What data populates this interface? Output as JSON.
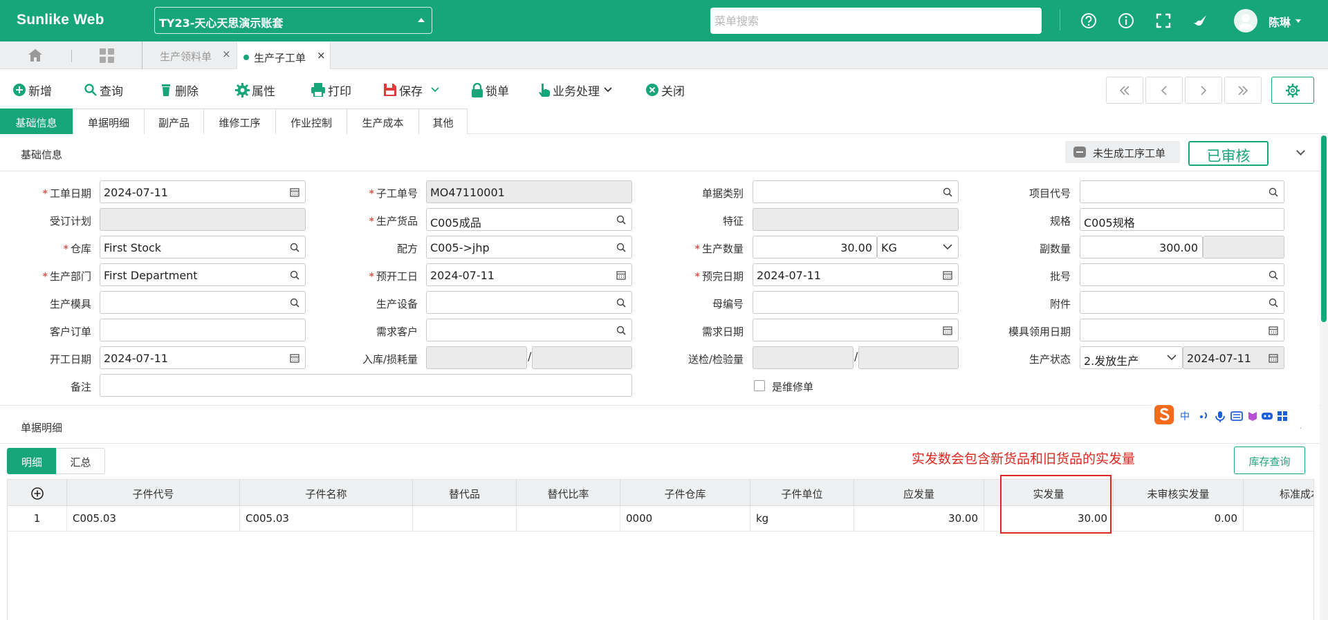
{
  "app": {
    "logo": "Sunlike Web",
    "account": "TY23-天心天思演示账套",
    "search_placeholder": "菜单搜索",
    "user_name": "陈琳",
    "icons": [
      "help-icon",
      "info-icon",
      "fullscreen-icon",
      "theme-icon"
    ]
  },
  "page_tabs": [
    {
      "label": "生产领料单",
      "active": false
    },
    {
      "label": "生产子工单",
      "active": true
    }
  ],
  "toolbar": {
    "new": "新增",
    "query": "查询",
    "delete": "删除",
    "properties": "属性",
    "print": "打印",
    "save": "保存",
    "lock": "锁单",
    "business": "业务处理",
    "close": "关闭"
  },
  "section_tabs": [
    "基础信息",
    "单据明细",
    "副产品",
    "维修工序",
    "作业控制",
    "生产成本",
    "其他"
  ],
  "basic_info": {
    "title": "基础信息",
    "not_generated_label": "未生成工序工单",
    "stamp": "已审核"
  },
  "fields": {
    "work_date": {
      "label": "工单日期",
      "value": "2024-07-11"
    },
    "sub_order_no": {
      "label": "子工单号",
      "value": "MO47110001"
    },
    "doc_category": {
      "label": "单据类别",
      "value": ""
    },
    "project_code": {
      "label": "项目代号",
      "value": ""
    },
    "order_plan": {
      "label": "受订计划",
      "value": ""
    },
    "product": {
      "label": "生产货品",
      "value": "C005成品"
    },
    "feature": {
      "label": "特征",
      "value": ""
    },
    "spec": {
      "label": "规格",
      "value": "C005规格"
    },
    "warehouse": {
      "label": "仓库",
      "value": "First Stock"
    },
    "formula": {
      "label": "配方",
      "value": "C005->jhp"
    },
    "prod_qty": {
      "label": "生产数量",
      "value": "30.00",
      "unit": "KG"
    },
    "sub_qty": {
      "label": "副数量",
      "value": "300.00"
    },
    "department": {
      "label": "生产部门",
      "value": "First Department"
    },
    "plan_start": {
      "label": "预开工日",
      "value": "2024-07-11"
    },
    "plan_finish": {
      "label": "预完日期",
      "value": "2024-07-11"
    },
    "batch_no": {
      "label": "批号",
      "value": ""
    },
    "mold": {
      "label": "生产模具",
      "value": ""
    },
    "equipment": {
      "label": "生产设备",
      "value": ""
    },
    "parent_no": {
      "label": "母编号",
      "value": ""
    },
    "attachment": {
      "label": "附件",
      "value": ""
    },
    "customer_order": {
      "label": "客户订单",
      "value": ""
    },
    "demand_customer": {
      "label": "需求客户",
      "value": ""
    },
    "demand_date": {
      "label": "需求日期",
      "value": ""
    },
    "mold_use_date": {
      "label": "模具领用日期",
      "value": ""
    },
    "start_date": {
      "label": "开工日期",
      "value": "2024-07-11"
    },
    "in_loss": {
      "label": "入库/损耗量",
      "value": ""
    },
    "inspect": {
      "label": "送检/检验量",
      "value": ""
    },
    "status": {
      "label": "生产状态",
      "value": "2.发放生产",
      "date": "2024-07-11"
    },
    "remark": {
      "label": "备注",
      "value": ""
    },
    "repair": {
      "label": "是维修单",
      "checked": false
    }
  },
  "detail": {
    "title": "单据明细",
    "tabs": [
      "明细",
      "汇总"
    ],
    "note": "实发数会包含新货品和旧货品的实发量",
    "stock_button": "库存查询",
    "columns": [
      "子件代号",
      "子件名称",
      "替代品",
      "替代比率",
      "子件仓库",
      "子件单位",
      "应发量",
      "实发量",
      "未审核实发量",
      "标准成本"
    ],
    "rows": [
      {
        "no": "1",
        "code": "C005.03",
        "name": "C005.03",
        "sub": "",
        "ratio": "",
        "wh": "0000",
        "unit": "kg",
        "due": "30.00",
        "actual": "30.00",
        "unaudited": "0.00",
        "std": ""
      }
    ]
  },
  "colors": {
    "brand": "#17a57a",
    "highlight": "#e0271f"
  }
}
